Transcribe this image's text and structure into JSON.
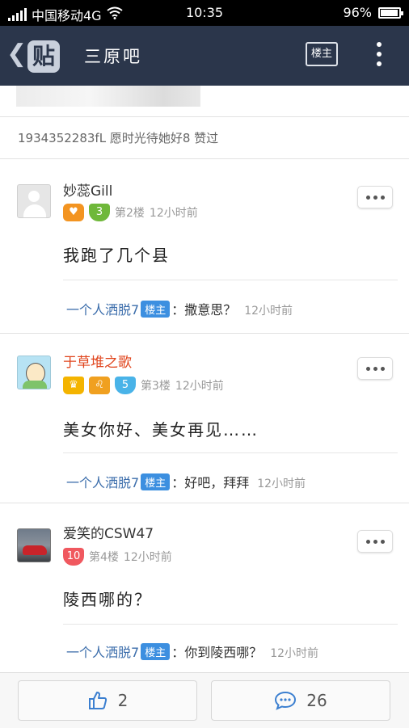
{
  "status_bar": {
    "carrier": "中国移动4G",
    "time": "10:35",
    "battery_percent": "96%",
    "battery_level": 0.96
  },
  "header": {
    "logo_glyph": "贴",
    "title": "三原吧",
    "host_only_label": "楼主"
  },
  "tagline": "1934352283fL 愿时光待她好8 赞过",
  "floors": [
    {
      "username": "妙蕊Gill",
      "level": "3",
      "floor": "第2楼",
      "time": "12小时前",
      "text": "我跑了几个县",
      "reply": {
        "name": "一个人洒脱7",
        "tag": "楼主",
        "text": "：撒意思？",
        "time": "12小时前"
      }
    },
    {
      "username": "于草堆之歌",
      "level": "5",
      "floor": "第3楼",
      "time": "12小时前",
      "text": "美女你好、美女再见……",
      "reply": {
        "name": "一个人洒脱7",
        "tag": "楼主",
        "text": "：好吧，拜拜",
        "time": "12小时前"
      }
    },
    {
      "username": "爱笑的CSW47",
      "level": "10",
      "floor": "第4楼",
      "time": "12小时前",
      "text": "陵西哪的？",
      "reply": {
        "name": "一个人洒脱7",
        "tag": "楼主",
        "text": "：你到陵西哪？",
        "time": "12小时前"
      }
    }
  ],
  "bottom_bar": {
    "like_count": "2",
    "comment_count": "26"
  },
  "colors": {
    "header_bg": "#2b364b",
    "host_tag": "#3c8fe0",
    "reply_name": "#3b6dab",
    "username_red": "#e0441c"
  }
}
